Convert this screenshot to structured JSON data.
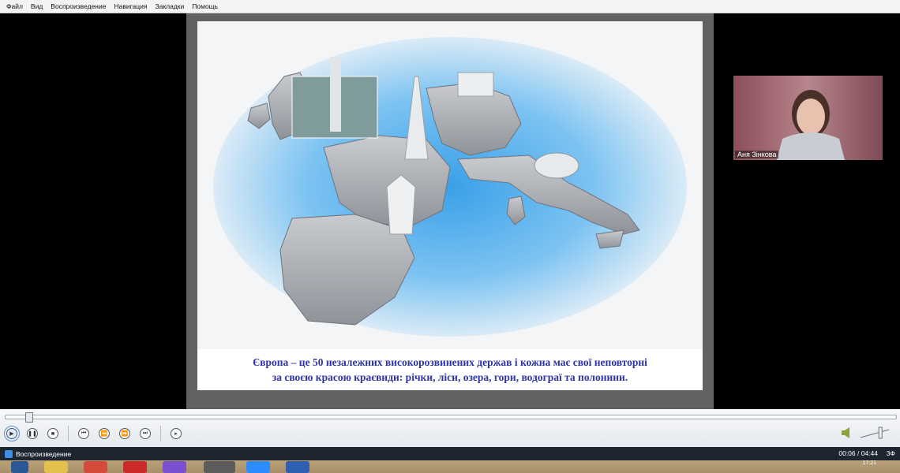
{
  "menu": [
    "Файл",
    "Вид",
    "Воспроизведение",
    "Навигация",
    "Закладки",
    "Помощь"
  ],
  "slide": {
    "caption_line1": "Європа – це 50 незалежних високорозвинених держав і кожна має свої неповторні",
    "caption_line2": "за своєю красою краєвиди: річки, ліси, озера, гори, водограї та полонини."
  },
  "webcam": {
    "name": "Аня Зінкова"
  },
  "player": {
    "progress": 0.022,
    "volume": 0.7,
    "controls": [
      "play-icon",
      "pause-icon",
      "stop-icon",
      "previous-icon",
      "rewind-icon",
      "forward-icon",
      "next-icon",
      "frame-step-icon"
    ]
  },
  "status": {
    "label": "Воспроизведение",
    "time": "00:06 / 04:44",
    "mode": "3Ф"
  },
  "taskbar": {
    "clock": "17:21"
  },
  "colors": {
    "caption_text": "#2d35a8",
    "status_bar": "#1e2430",
    "accent": "#3a8ee6"
  }
}
